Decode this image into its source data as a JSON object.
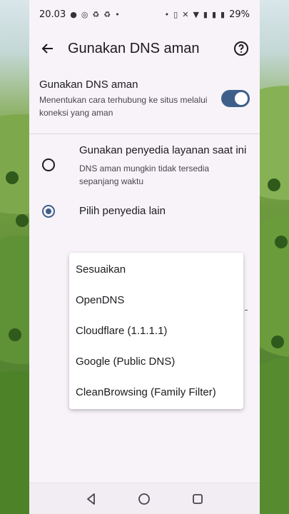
{
  "status_bar": {
    "time": "20.03",
    "battery": "29%"
  },
  "app_bar": {
    "title": "Gunakan DNS aman"
  },
  "secure_dns": {
    "title": "Gunakan DNS aman",
    "description": "Menentukan cara terhubung ke situs melalui koneksi yang aman",
    "enabled": true
  },
  "options": [
    {
      "title": "Gunakan penyedia layanan saat ini",
      "description": "DNS aman mungkin tidak tersedia sepanjang waktu",
      "selected": false
    },
    {
      "title": "Pilih penyedia lain",
      "description": "",
      "selected": true
    }
  ],
  "provider_dropdown": {
    "items": [
      "Sesuaikan",
      "OpenDNS",
      "Cloudflare (1.1.1.1)",
      "Google (Public DNS)",
      "CleanBrowsing (Family Filter)"
    ]
  },
  "colors": {
    "accent": "#3e5f8a",
    "surface": "#f7f3f8"
  }
}
